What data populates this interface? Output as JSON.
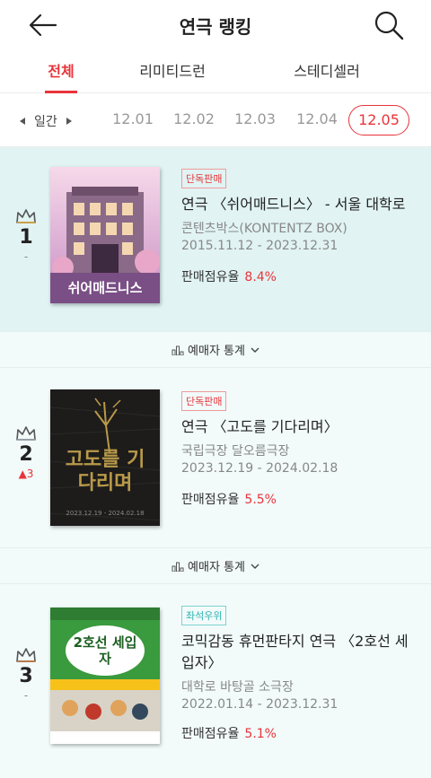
{
  "header": {
    "title": "연극 랭킹"
  },
  "tabs": [
    {
      "label": "전체",
      "active": true
    },
    {
      "label": "리미티드런",
      "active": false
    },
    {
      "label": "스테디셀러",
      "active": false
    }
  ],
  "period": {
    "label": "일간"
  },
  "dates": [
    "12.01",
    "12.02",
    "12.03",
    "12.04",
    "12.05"
  ],
  "selected_date": "12.05",
  "stat_bar_label": "예매자 통계",
  "items": [
    {
      "rank": "1",
      "change": "-",
      "badge": "단독판매",
      "title": "연극 〈쉬어매드니스〉 - 서울 대학로",
      "venue": "콘텐츠박스(KONTENTZ BOX)",
      "dates": "2015.11.12 - 2023.12.31",
      "share_label": "판매점유율",
      "share": "8.4%",
      "poster_text": "쉬어매드니스"
    },
    {
      "rank": "2",
      "change": "▲3",
      "badge": "단독판매",
      "title": "연극 〈고도를 기다리며〉",
      "venue": "국립극장 달오름극장",
      "dates": "2023.12.19 - 2024.02.18",
      "share_label": "판매점유율",
      "share": "5.5%",
      "poster_text": "고도를 기다리며"
    },
    {
      "rank": "3",
      "change": "-",
      "badge": "좌석우위",
      "title": "코믹감동 휴먼판타지 연극 〈2호선 세입자〉",
      "venue": "대학로 바탕골 소극장",
      "dates": "2022.01.14 - 2023.12.31",
      "share_label": "판매점유율",
      "share": "5.1%",
      "poster_text": "2호선 세입자"
    }
  ],
  "colors": {
    "accent": "#e8343a",
    "teal": "#2bb4b0",
    "highlight_bg": "#e1f3f3"
  }
}
